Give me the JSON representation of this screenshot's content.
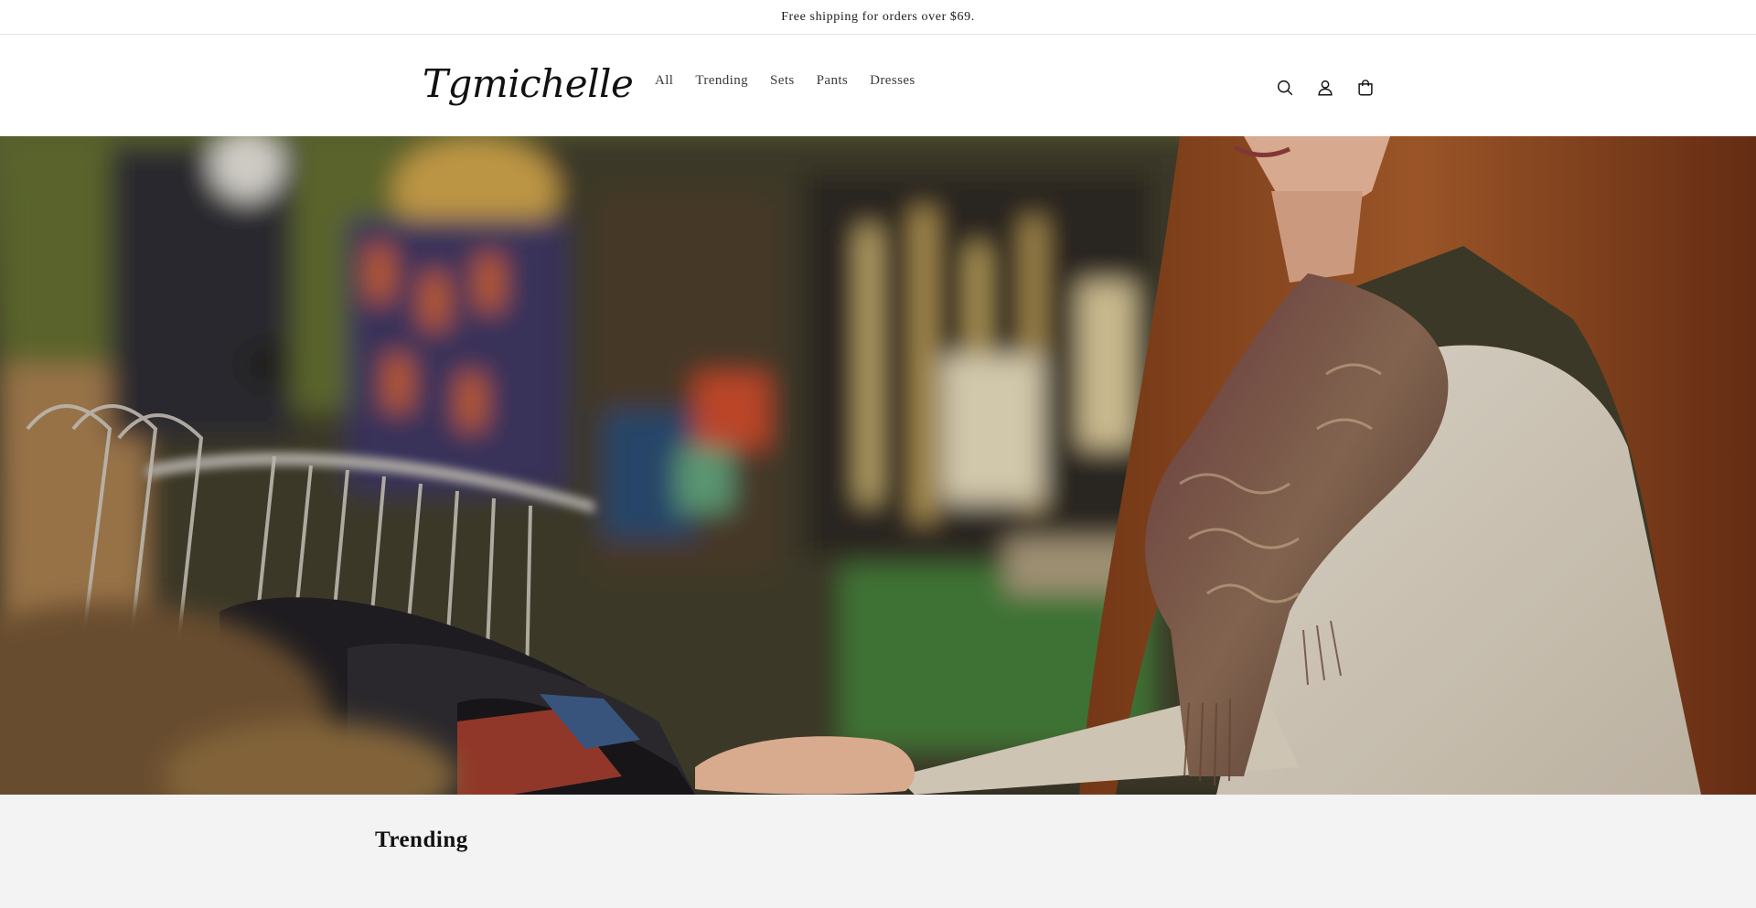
{
  "announcement": {
    "text": "Free shipping for orders over $69."
  },
  "header": {
    "logo": "Tgmichelle",
    "nav": [
      {
        "label": "All"
      },
      {
        "label": "Trending"
      },
      {
        "label": "Sets"
      },
      {
        "label": "Pants"
      },
      {
        "label": "Dresses"
      }
    ],
    "icons": [
      "search-icon",
      "account-icon",
      "cart-icon"
    ]
  },
  "hero": {
    "image": "woman-in-scarf-browsing-clothing-rack"
  },
  "featured": {
    "title": "Trending"
  },
  "colors": {
    "page_background": "#f3f3f3",
    "header_background": "#ffffff",
    "text": "#121212"
  }
}
